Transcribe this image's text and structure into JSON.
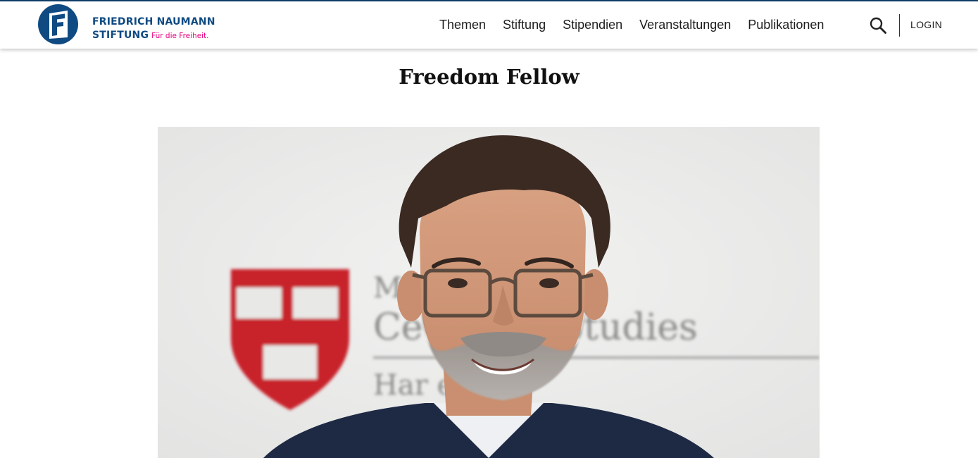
{
  "brand": {
    "name_line1": "FRIEDRICH NAUMANN",
    "name_line2": "STIFTUNG",
    "tagline": "Für die Freiheit.",
    "logo_letter": "F",
    "primary_color": "#0f4a82",
    "accent_color": "#e5007d"
  },
  "nav": {
    "items": [
      {
        "label": "Themen"
      },
      {
        "label": "Stiftung"
      },
      {
        "label": "Stipendien"
      },
      {
        "label": "Veranstaltungen"
      },
      {
        "label": "Publikationen"
      }
    ],
    "search_icon": "search-icon",
    "login_label": "LOGIN"
  },
  "page": {
    "title": "Freedom Fellow"
  },
  "hero": {
    "background_text": {
      "line1": "Mi          urg",
      "line2": "Ce          opean Studies",
      "line3": "Har          ersity"
    }
  }
}
